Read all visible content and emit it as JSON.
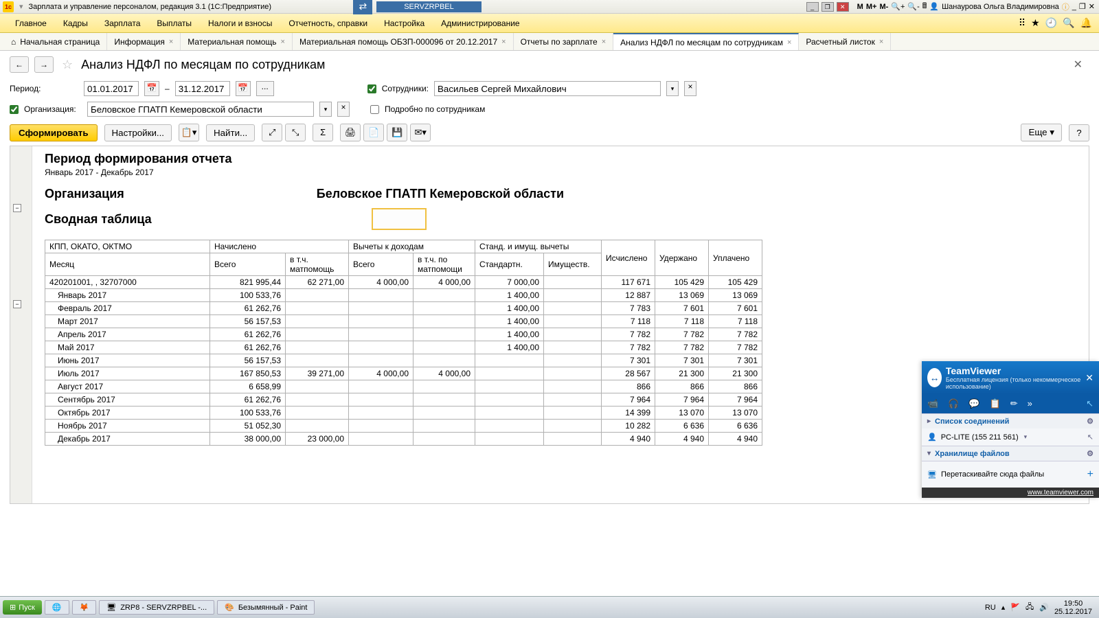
{
  "titlebar": {
    "app_title": "Зарплата и управление персоналом, редакция 3.1  (1С:Предприятие)",
    "server": "SERVZRPBEL",
    "user": "Шанаурова Ольга Владимировна",
    "m_btns": [
      "M",
      "M+",
      "M-"
    ]
  },
  "menu": {
    "items": [
      "Главное",
      "Кадры",
      "Зарплата",
      "Выплаты",
      "Налоги и взносы",
      "Отчетность, справки",
      "Настройка",
      "Администрирование"
    ]
  },
  "tabs": [
    {
      "label": "Начальная страница",
      "closable": false,
      "home": true
    },
    {
      "label": "Информация",
      "closable": true
    },
    {
      "label": "Материальная помощь",
      "closable": true
    },
    {
      "label": "Материальная помощь ОБЗП-000096 от 20.12.2017",
      "closable": true
    },
    {
      "label": "Отчеты по зарплате",
      "closable": true
    },
    {
      "label": "Анализ НДФЛ по месяцам по сотрудникам",
      "closable": true,
      "active": true
    },
    {
      "label": "Расчетный листок",
      "closable": true
    }
  ],
  "page": {
    "title": "Анализ НДФЛ по месяцам по сотрудникам"
  },
  "filters": {
    "period_label": "Период:",
    "date_from": "01.01.2017",
    "date_to": "31.12.2017",
    "dash": "–",
    "ellipsis": "...",
    "employees_label": "Сотрудники:",
    "employees_value": "Васильев Сергей Михайлович",
    "org_label": "Организация:",
    "org_value": "Беловское ГПАТП Кемеровской области",
    "detail_label": "Подробно по сотрудникам"
  },
  "toolbar": {
    "generate": "Сформировать",
    "settings": "Настройки...",
    "find": "Найти...",
    "more": "Еще",
    "help": "?"
  },
  "report": {
    "h1": "Период формирования отчета",
    "period_text": "Январь 2017 - Декабрь 2017",
    "org_label": "Организация",
    "org_name": "Беловское ГПАТП Кемеровской области",
    "summary_label": "Сводная таблица",
    "headers_top": [
      "КПП, ОКАТО, ОКТМО",
      "Начислено",
      "Вычеты к доходам",
      "Станд. и имущ. вычеты",
      "Исчислено",
      "Удержано",
      "Уплачено"
    ],
    "headers_bot": [
      "Месяц",
      "Всего",
      "в т.ч. матпомощь",
      "Всего",
      "в т.ч. по матпомощи",
      "Стандартн.",
      "Имуществ."
    ],
    "total_row": [
      "420201001, , 32707000",
      "821 995,44",
      "62 271,00",
      "4 000,00",
      "4 000,00",
      "7 000,00",
      "",
      "117 671",
      "105 429",
      "105 429"
    ],
    "rows": [
      [
        "Январь 2017",
        "100 533,76",
        "",
        "",
        "",
        "1 400,00",
        "",
        "12 887",
        "13 069",
        "13 069"
      ],
      [
        "Февраль 2017",
        "61 262,76",
        "",
        "",
        "",
        "1 400,00",
        "",
        "7 783",
        "7 601",
        "7 601"
      ],
      [
        "Март 2017",
        "56 157,53",
        "",
        "",
        "",
        "1 400,00",
        "",
        "7 118",
        "7 118",
        "7 118"
      ],
      [
        "Апрель 2017",
        "61 262,76",
        "",
        "",
        "",
        "1 400,00",
        "",
        "7 782",
        "7 782",
        "7 782"
      ],
      [
        "Май 2017",
        "61 262,76",
        "",
        "",
        "",
        "1 400,00",
        "",
        "7 782",
        "7 782",
        "7 782"
      ],
      [
        "Июнь 2017",
        "56 157,53",
        "",
        "",
        "",
        "",
        "",
        "7 301",
        "7 301",
        "7 301"
      ],
      [
        "Июль 2017",
        "167 850,53",
        "39 271,00",
        "4 000,00",
        "4 000,00",
        "",
        "",
        "28 567",
        "21 300",
        "21 300"
      ],
      [
        "Август 2017",
        "6 658,99",
        "",
        "",
        "",
        "",
        "",
        "866",
        "866",
        "866"
      ],
      [
        "Сентябрь 2017",
        "61 262,76",
        "",
        "",
        "",
        "",
        "",
        "7 964",
        "7 964",
        "7 964"
      ],
      [
        "Октябрь 2017",
        "100 533,76",
        "",
        "",
        "",
        "",
        "",
        "14 399",
        "13 070",
        "13 070"
      ],
      [
        "Ноябрь 2017",
        "51 052,30",
        "",
        "",
        "",
        "",
        "",
        "10 282",
        "6 636",
        "6 636"
      ],
      [
        "Декабрь 2017",
        "38 000,00",
        "23 000,00",
        "",
        "",
        "",
        "",
        "4 940",
        "4 940",
        "4 940"
      ]
    ]
  },
  "teamviewer": {
    "title": "TeamViewer",
    "subtitle": "Бесплатная лицензия (только некоммерческое использование)",
    "connections": "Список соединений",
    "peer": "PC-LITE (155 211 561)",
    "storage": "Хранилище файлов",
    "drop": "Перетаскивайте сюда файлы",
    "footer": "www.teamviewer.com"
  },
  "taskbar": {
    "start": "Пуск",
    "items": [
      "ZRP8 - SERVZRPBEL -...",
      "Безымянный - Paint"
    ],
    "lang": "RU",
    "time": "19:50",
    "date": "25.12.2017"
  }
}
